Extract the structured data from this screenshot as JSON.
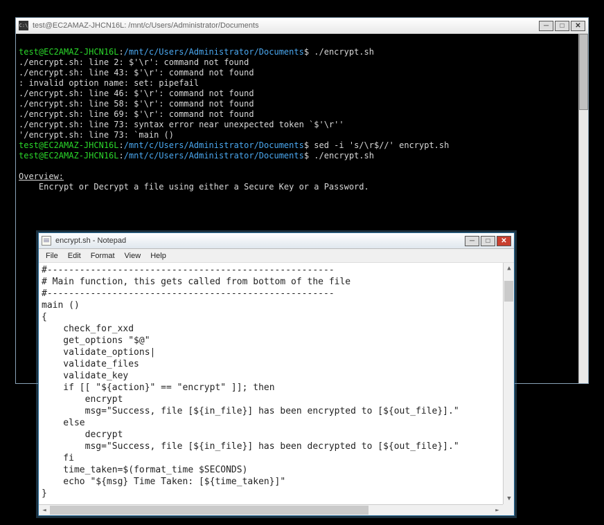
{
  "terminal": {
    "title": "test@EC2AMAZ-JHCN16L: /mnt/c/Users/Administrator/Documents",
    "icon_label": "C:\\",
    "prompt": {
      "user": "test@EC2AMAZ-JHCN16L",
      "colon": ":",
      "path": "/mnt/c/Users/Administrator/Documents",
      "dollar": "$"
    },
    "cmd1": " ./encrypt.sh",
    "out": [
      "./encrypt.sh: line 2: $'\\r': command not found",
      "./encrypt.sh: line 43: $'\\r': command not found",
      ": invalid option name: set: pipefail",
      "./encrypt.sh: line 46: $'\\r': command not found",
      "./encrypt.sh: line 58: $'\\r': command not found",
      "./encrypt.sh: line 69: $'\\r': command not found",
      "./encrypt.sh: line 73: syntax error near unexpected token `$'\\r''",
      "'/encrypt.sh: line 73: `main ()"
    ],
    "cmd2": " sed -i 's/\\r$//' encrypt.sh",
    "cmd3": " ./encrypt.sh",
    "overview_header": "Overview:",
    "overview_text": "    Encrypt or Decrypt a file using either a Secure Key or a Password."
  },
  "notepad": {
    "title": "encrypt.sh - Notepad",
    "menus": [
      "File",
      "Edit",
      "Format",
      "View",
      "Help"
    ],
    "content": "#-----------------------------------------------------\n# Main function, this gets called from bottom of the file\n#-----------------------------------------------------\nmain ()\n{\n    check_for_xxd\n    get_options \"$@\"\n    validate_options|\n    validate_files\n    validate_key\n    if [[ \"${action}\" == \"encrypt\" ]]; then\n        encrypt\n        msg=\"Success, file [${in_file}] has been encrypted to [${out_file}].\"\n    else\n        decrypt\n        msg=\"Success, file [${in_file}] has been decrypted to [${out_file}].\"\n    fi\n    time_taken=$(format_time $SECONDS)\n    echo \"${msg} Time Taken: [${time_taken}]\"\n}"
  }
}
